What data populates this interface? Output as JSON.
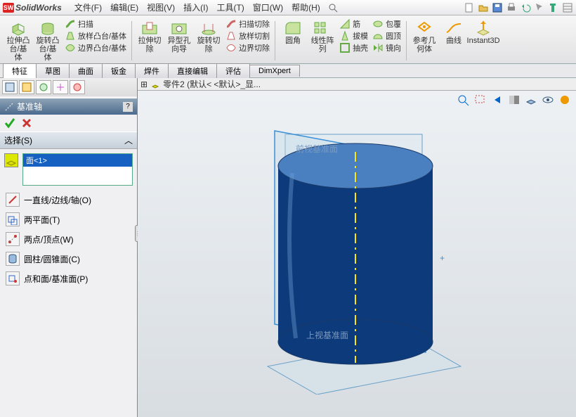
{
  "app": {
    "name": "SolidWorks",
    "logo": "SW"
  },
  "menu": {
    "file": "文件(F)",
    "edit": "编辑(E)",
    "view": "视图(V)",
    "insert": "插入(I)",
    "tools": "工具(T)",
    "window": "窗口(W)",
    "help": "帮助(H)"
  },
  "ribbon": {
    "extrude": "拉伸凸\n台/基体",
    "revolve": "旋转凸\n台/基体",
    "sweep": "扫描",
    "loft": "放样凸台/基体",
    "boundary": "边界凸台/基体",
    "extruded_cut": "拉伸切\n除",
    "hole_wizard": "异型孔\n向导",
    "revolved_cut": "旋转切\n除",
    "swept_cut": "扫描切除",
    "lofted_cut": "放样切割",
    "boundary_cut": "边界切除",
    "fillet": "圆角",
    "linear_pattern": "线性阵\n列",
    "rib": "筋",
    "draft": "拔模",
    "shell": "抽壳",
    "wrap": "包覆",
    "dome": "圆顶",
    "mirror": "镜向",
    "refgeom": "参考几\n何体",
    "curves": "曲线",
    "instant3d": "Instant3D"
  },
  "tabs": {
    "feature": "特征",
    "sketch": "草图",
    "surface": "曲面",
    "sheetmetal": "钣金",
    "weldment": "焊件",
    "direct_edit": "直接编辑",
    "evaluate": "评估",
    "dimxpert": "DimXpert"
  },
  "feature_mgr": {
    "title": "基准轴",
    "select_hdr": "选择(S)",
    "face_item": "面<1>",
    "opt_line": "一直线/边线/轴(O)",
    "opt_twoplane": "两平面(T)",
    "opt_twopoint": "两点/顶点(W)",
    "opt_cylinder": "圆柱/圆锥面(C)",
    "opt_pointface": "点和面/基准面(P)"
  },
  "document": {
    "title": "零件2  (默认< <默认>_显..."
  },
  "planes": {
    "front": "前视基准面",
    "top": "上视基准面"
  },
  "colors": {
    "accent": "#1560c0",
    "body": "#0d3a7a",
    "axis": "#ffe600"
  }
}
